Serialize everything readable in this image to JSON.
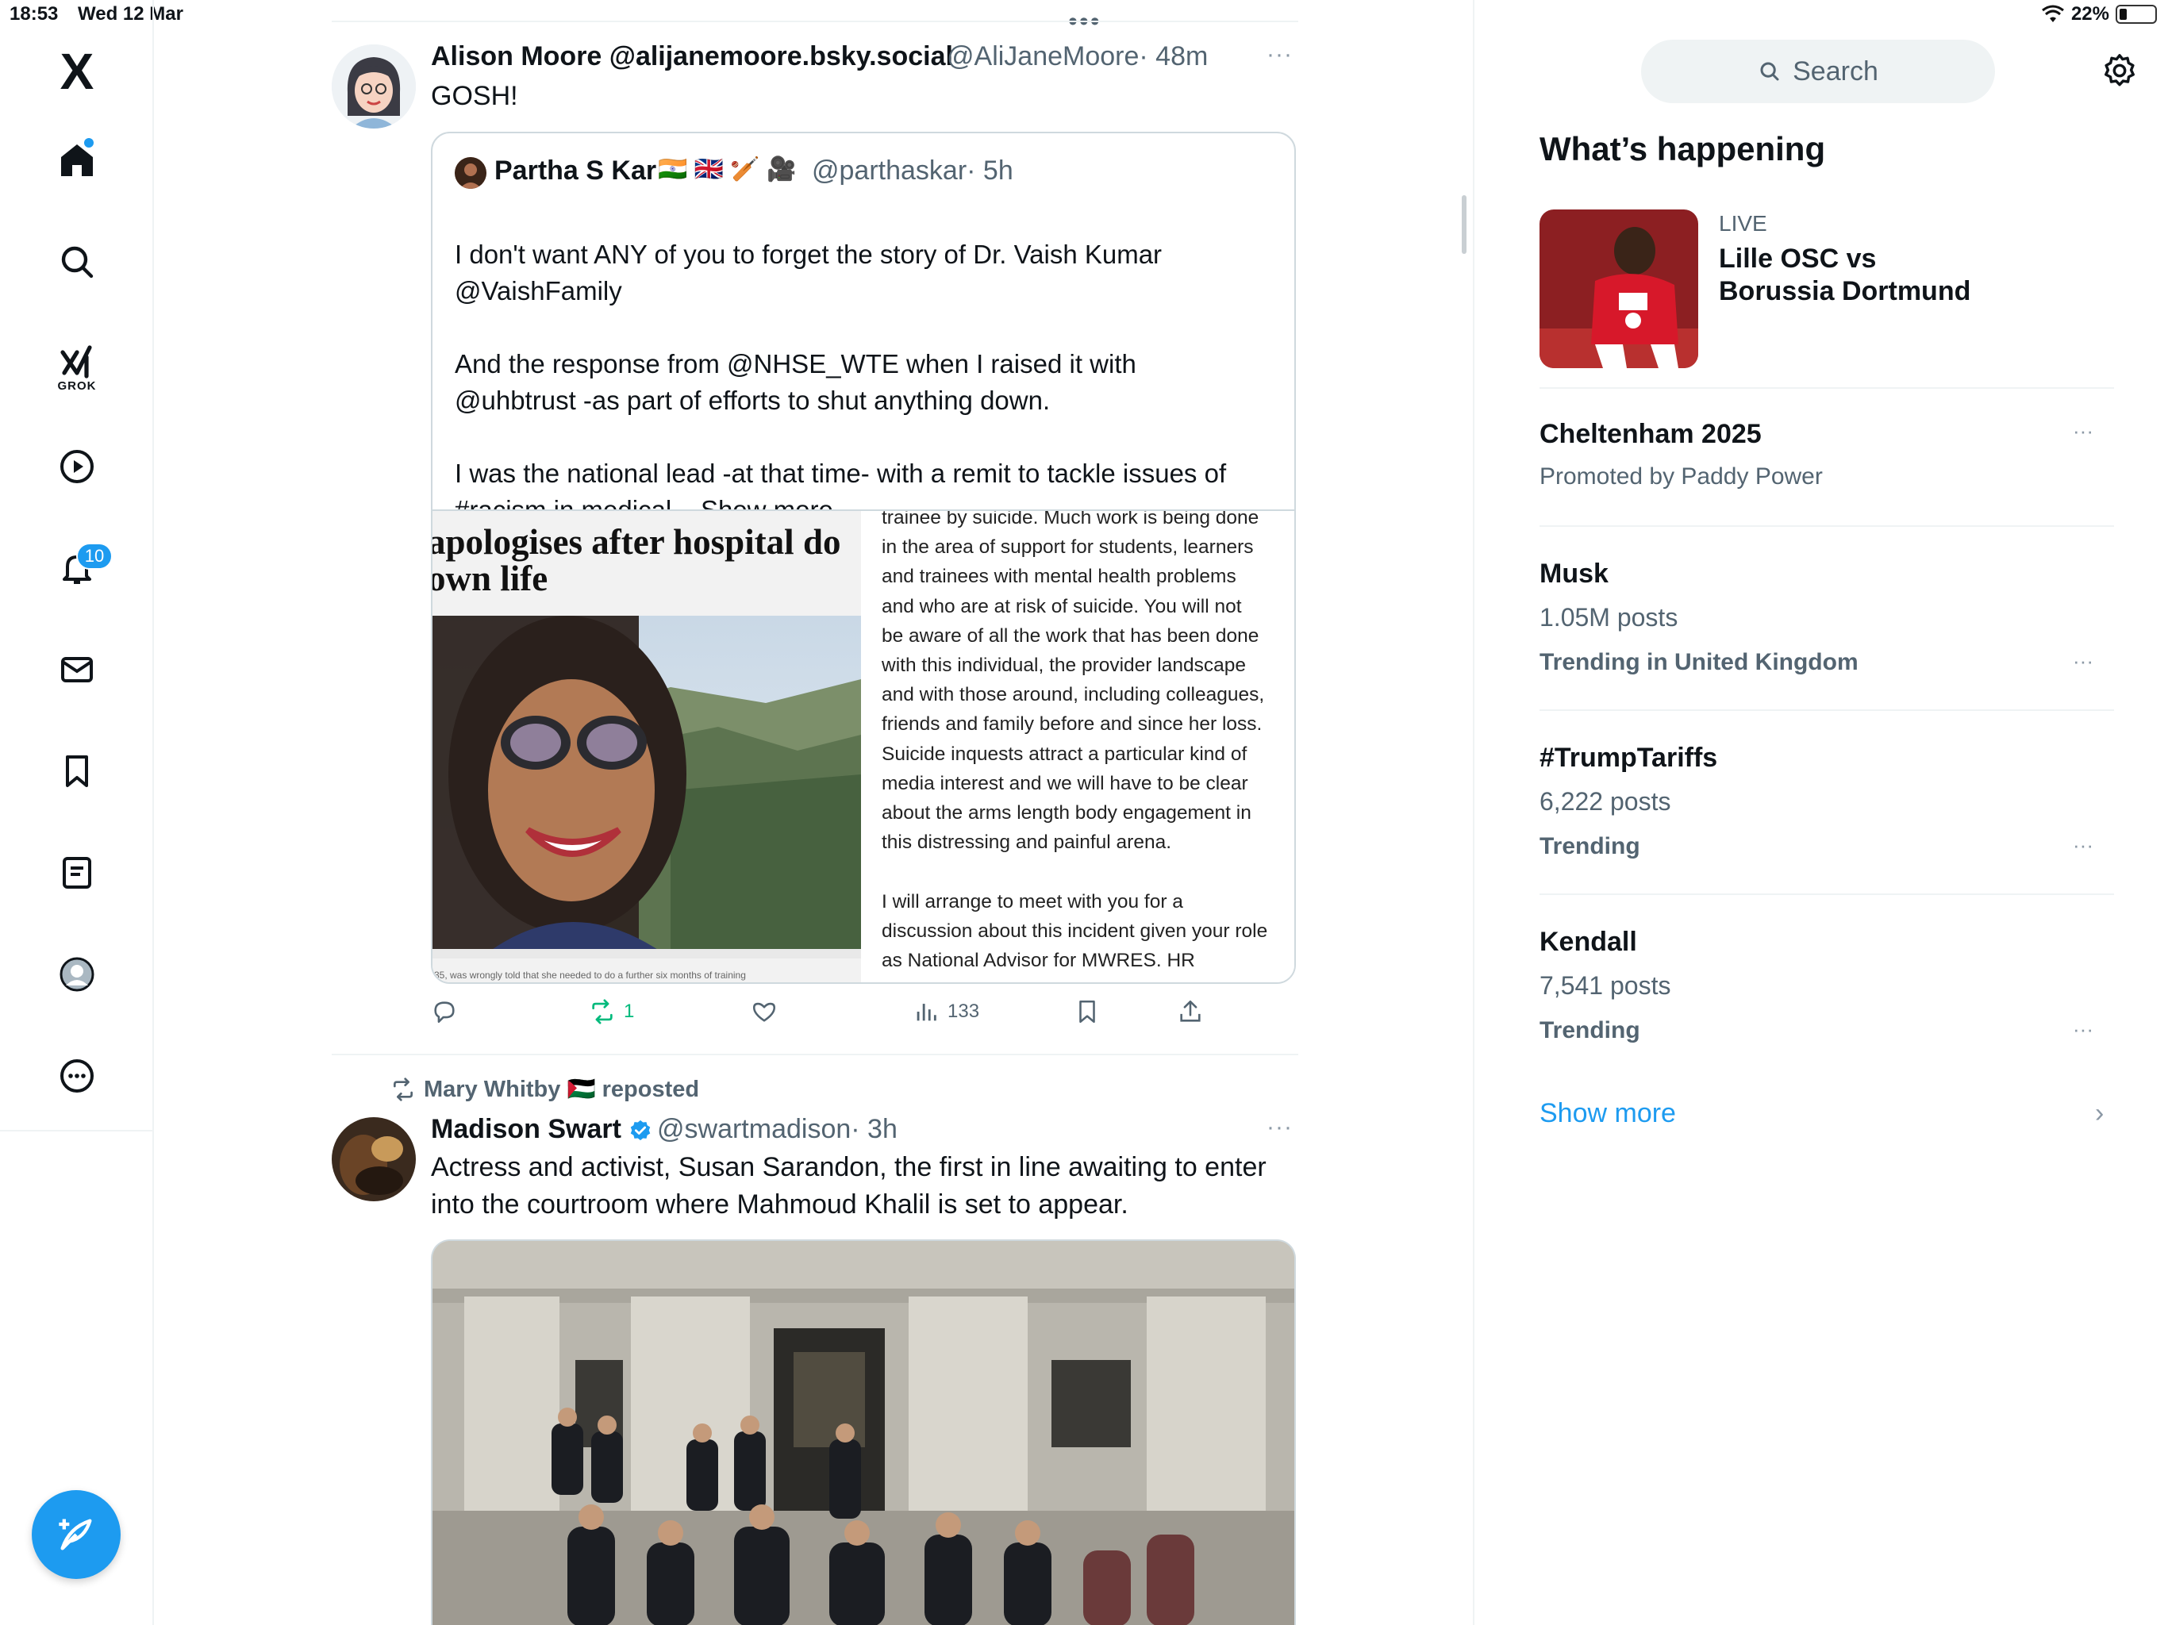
{
  "status_bar": {
    "time": "18:53",
    "date": "Wed 12 Mar",
    "battery": "22%",
    "battery_level": 0.22
  },
  "nav": {
    "logo": "X",
    "grok_label": "GROK",
    "notification_count": "10",
    "icons": [
      "home-icon",
      "search-icon",
      "grok-icon",
      "video-icon",
      "bell-icon",
      "mail-icon",
      "bookmark-icon",
      "lists-icon",
      "profile-icon",
      "more-icon",
      "compose-icon"
    ]
  },
  "feed": {
    "top_dots": "•••",
    "tweet1": {
      "name": "Alison Moore @alijanemoore.bsky.social",
      "handle": "@AliJaneMoore",
      "time": "· 48m",
      "more": "···",
      "text": "GOSH!",
      "quote": {
        "name": "Partha S Kar",
        "flags": "🇮🇳 🇬🇧 🏏 🎥",
        "handle": "@parthaskar",
        "time": "· 5h",
        "text": "I don't want ANY of you to forget the story of Dr. Vaish Kumar\n@VaishFamily\n\nAnd the response from @NHSE_WTE when I raised it with\n@uhbtrust -as part of efforts to shut anything down.\n\nI was the national lead -at that time- with a remit to tackle issues of\n#racism in medical...",
        "show_more": "Show more",
        "media": {
          "headline": "apologises after hospital do\nown life",
          "caption": "35, was wrongly told that she needed to do a further six months of training",
          "letter_text": "trainee by suicide. Much work is being done\nin the area of support for students, learners\nand trainees with mental health problems\nand who are at risk of suicide. You will not\nbe aware of all the work that has been done\nwith this individual, the provider landscape\nand with those around, including colleagues,\nfriends and family before and since her loss.\nSuicide inquests attract a particular kind of\nmedia interest and we will have to be clear\nabout the arms length body engagement in\nthis distressing and painful arena.\n\nI will arrange to meet with you for a\ndiscussion about this incident given your role\nas National Advisor for MWRES. HR"
        }
      },
      "actions": {
        "reposts": "1",
        "views": "133"
      }
    },
    "tweet2": {
      "reposted_by": "Mary Whitby 🇵🇸 reposted",
      "name": "Madison Swart",
      "handle": "@swartmadison",
      "time": "· 3h",
      "more": "···",
      "text": "Actress and activist, Susan Sarandon, the first in line awaiting to enter\ninto the courtroom where Mahmoud Khalil is set to appear."
    }
  },
  "sidebar": {
    "search_placeholder": "Search",
    "section_title": "What’s happening",
    "live": {
      "label": "LIVE",
      "title": "Lille OSC vs\nBorussia Dortmund"
    },
    "trends": [
      {
        "name": "Cheltenham 2025",
        "line2": "Promoted by Paddy Power",
        "line3": ""
      },
      {
        "name": "Musk",
        "line2": "1.05M posts",
        "line3": "Trending in United Kingdom"
      },
      {
        "name": "#TrumpTariffs",
        "line2": "6,222 posts",
        "line3": "Trending"
      },
      {
        "name": "Kendall",
        "line2": "7,541 posts",
        "line3": "Trending"
      }
    ],
    "show_more": "Show more",
    "dots": "···"
  },
  "colors": {
    "accent": "#1d9bf0",
    "text": "#0f1419",
    "secondary": "#536471",
    "repost_green": "#00ba7c",
    "border": "#eff3f4"
  }
}
